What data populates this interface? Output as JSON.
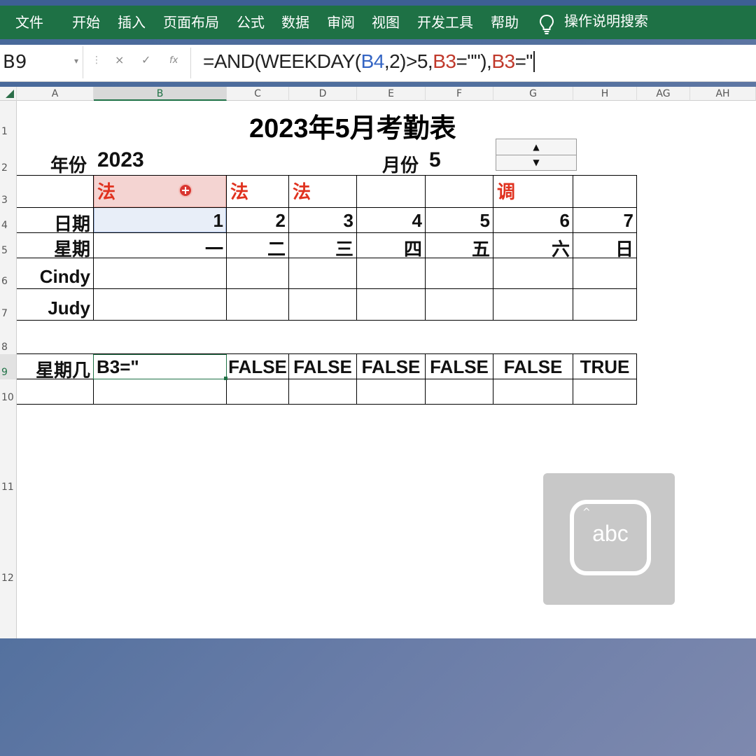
{
  "ribbon": {
    "tabs": [
      "文件",
      "开始",
      "插入",
      "页面布局",
      "公式",
      "数据",
      "审阅",
      "视图",
      "开发工具",
      "帮助"
    ],
    "tell_me": "操作说明搜索"
  },
  "formula_bar": {
    "name_box": "B9",
    "cancel_glyph": "×",
    "enter_glyph": "✓",
    "fx_glyph": "fx",
    "formula_parts": [
      {
        "text": "=AND(WEEKDAY(",
        "color": "#222222"
      },
      {
        "text": "B4",
        "color": "#3465c4"
      },
      {
        "text": ",2)>5,",
        "color": "#222222"
      },
      {
        "text": "B3",
        "color": "#c0392b"
      },
      {
        "text": "=\"\"),",
        "color": "#222222"
      },
      {
        "text": "B3",
        "color": "#c0392b"
      },
      {
        "text": "=\"",
        "color": "#222222"
      }
    ]
  },
  "columns": [
    "A",
    "B",
    "C",
    "D",
    "E",
    "F",
    "G",
    "H",
    "AG",
    "AH"
  ],
  "rows": [
    "1",
    "2",
    "3",
    "4",
    "5",
    "6",
    "7",
    "8",
    "9",
    "10",
    "11",
    "12"
  ],
  "sheet": {
    "title": "2023年5月考勤表",
    "year_label": "年份",
    "year_value": "2023",
    "month_label": "月份",
    "month_value": "5",
    "row3_marks": [
      "法",
      "法",
      "法",
      "",
      "",
      "调",
      ""
    ],
    "date_label": "日期",
    "dates": [
      "1",
      "2",
      "3",
      "4",
      "5",
      "6",
      "7"
    ],
    "weekday_label": "星期",
    "weekdays": [
      "一",
      "二",
      "三",
      "四",
      "五",
      "六",
      "日"
    ],
    "names": [
      "Cindy",
      "Judy"
    ],
    "row9_label": "星期几",
    "row9_editing": "B3=\"",
    "row9_values": [
      "FALSE",
      "FALSE",
      "FALSE",
      "FALSE",
      "FALSE",
      "TRUE"
    ]
  },
  "ime": {
    "label": "abc",
    "icon": "abc-keyboard-icon"
  },
  "colors": {
    "ribbon": "#1e7145",
    "accent_red": "#e0321f",
    "ref_blue": "#3465c4"
  }
}
